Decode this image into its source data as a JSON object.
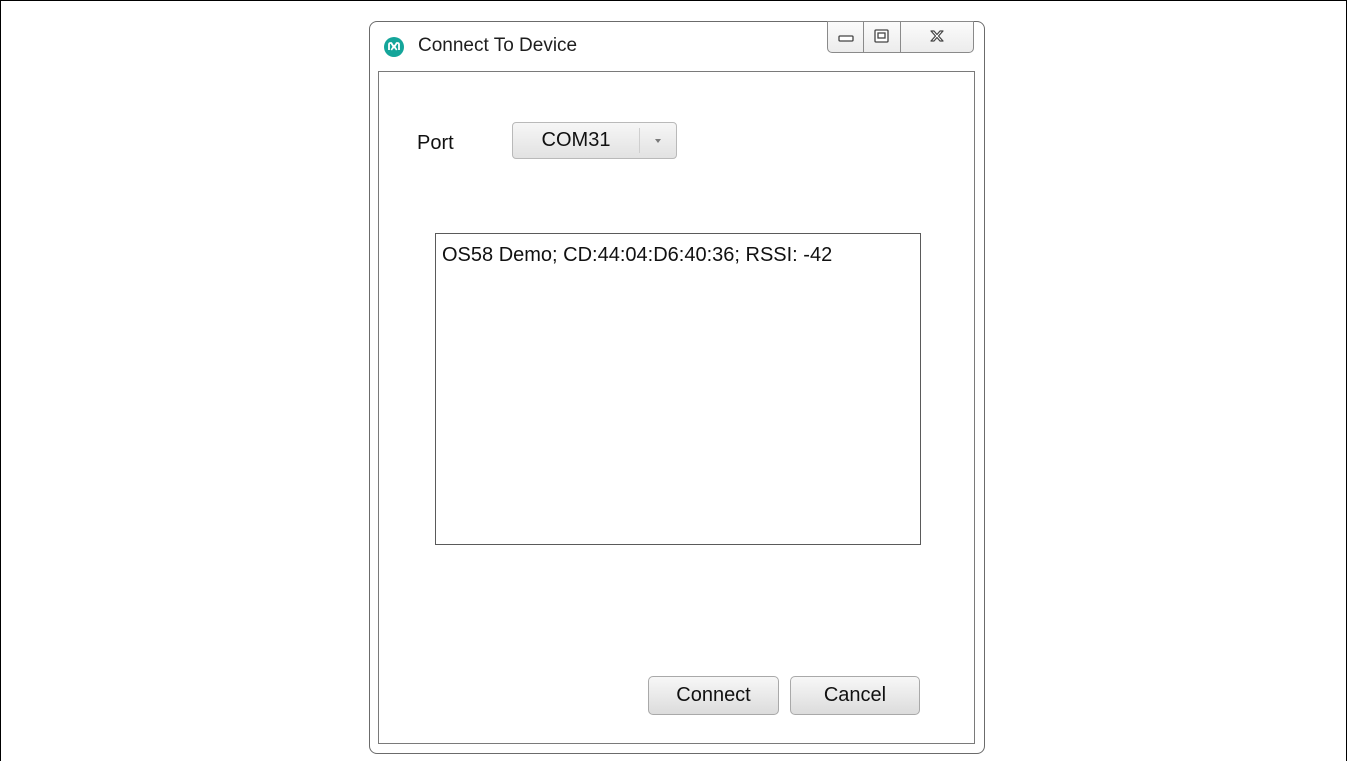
{
  "window": {
    "title": "Connect To Device",
    "icon": "maxim-logo-icon",
    "accent_color": "#14a59a",
    "controls": [
      "minimize-icon",
      "restore-icon",
      "close-icon"
    ]
  },
  "port": {
    "label": "Port",
    "selected": "COM31"
  },
  "device_list": {
    "items": [
      {
        "label": "OS58 Demo; CD:44:04:D6:40:36; RSSI: -42"
      }
    ]
  },
  "buttons": {
    "connect_label": "Connect",
    "cancel_label": "Cancel"
  }
}
